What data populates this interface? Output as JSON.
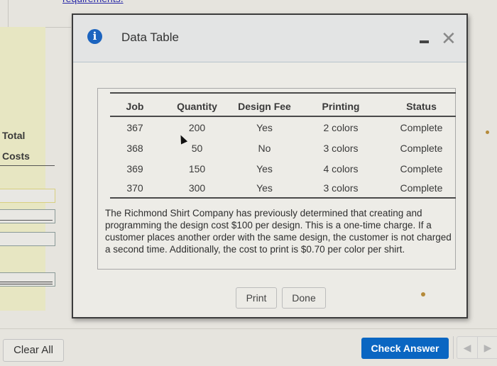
{
  "background": {
    "top_link_text": "requirements.",
    "total_costs_label_line1": "Total",
    "total_costs_label_line2": "Costs"
  },
  "modal": {
    "title": "Data Table",
    "info_icon": "info-icon",
    "minimize_icon": "minimize-icon",
    "close_icon": "close-icon",
    "table": {
      "columns": [
        "Job",
        "Quantity",
        "Design Fee",
        "Printing",
        "Status"
      ],
      "rows": [
        [
          "367",
          "200",
          "Yes",
          "2 colors",
          "Complete"
        ],
        [
          "368",
          "50",
          "No",
          "3 colors",
          "Complete"
        ],
        [
          "369",
          "150",
          "Yes",
          "4 colors",
          "Complete"
        ],
        [
          "370",
          "300",
          "Yes",
          "3 colors",
          "Complete"
        ]
      ]
    },
    "description": "The Richmond Shirt Company has previously determined that creating and programming the design cost $100 per design. This is a one-time charge. If a customer places another order with the same design, the customer is not charged a second time. Additionally, the cost to print is $0.70 per color per shirt.",
    "print_label": "Print",
    "done_label": "Done"
  },
  "footer": {
    "clear_all_label": "Clear All",
    "check_answer_label": "Check Answer",
    "prev_icon": "◀",
    "next_icon": "▶"
  },
  "colors": {
    "accent": "#0a66c2",
    "info_icon": "#1c64bf",
    "panel_yellow": "#e7e6c2"
  }
}
